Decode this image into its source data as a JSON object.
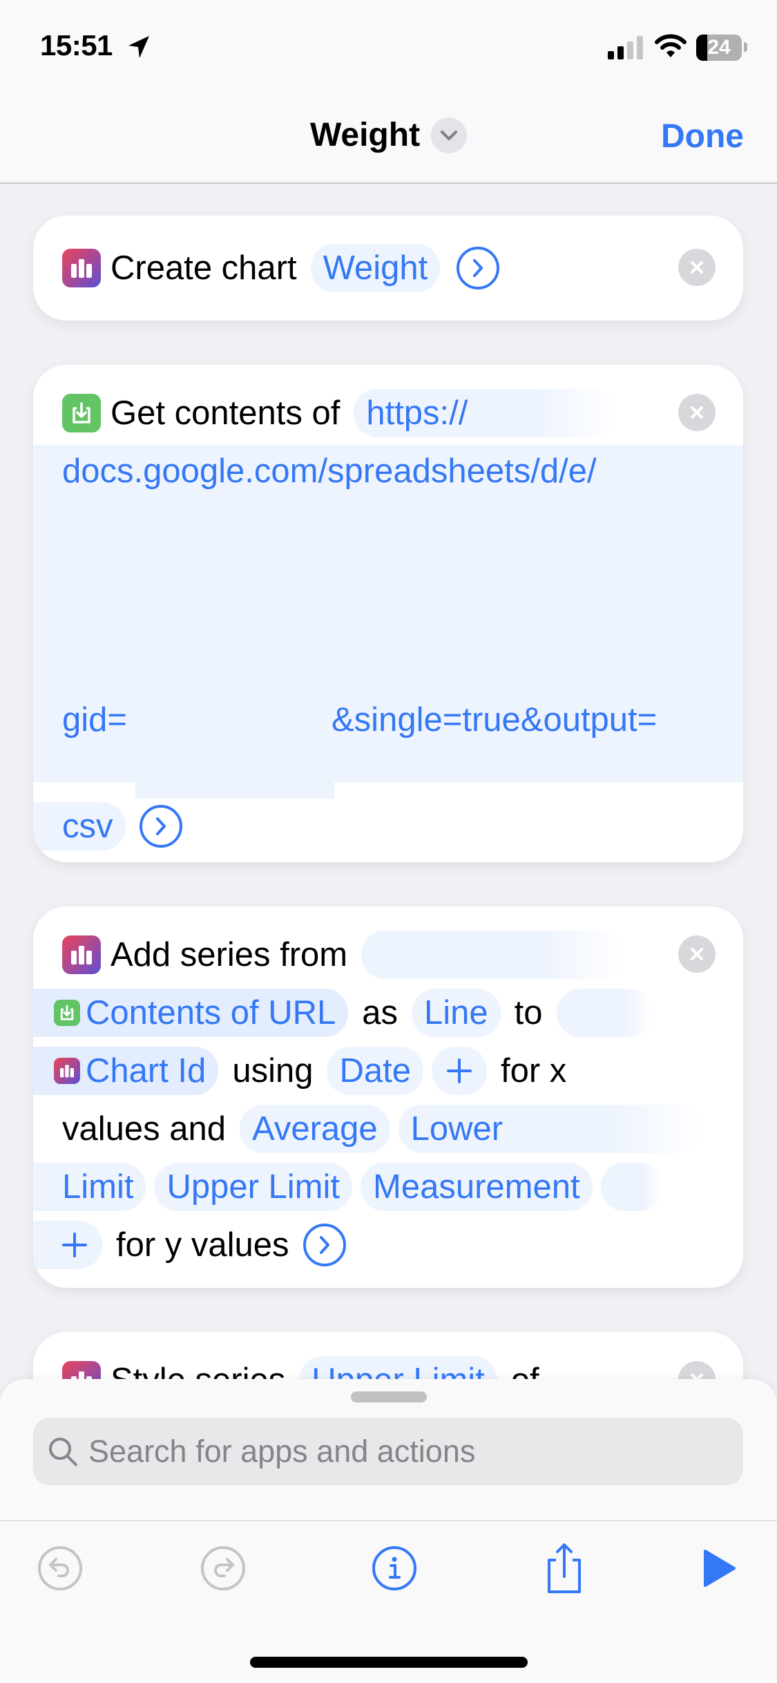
{
  "status_bar": {
    "time": "15:51",
    "battery_percent": "24",
    "battery_level": 0.24,
    "signal_bars_active": 2,
    "signal_bars_total": 4
  },
  "nav": {
    "title": "Weight",
    "done_label": "Done"
  },
  "actions": [
    {
      "app": "Charts",
      "icon": "chart-bars-icon",
      "label": "Create chart",
      "params": {
        "name": "Weight"
      }
    },
    {
      "app": "Web",
      "icon": "download-icon",
      "label": "Get contents of",
      "url_lines": [
        "https://",
        "docs.google.com/spreadsheets/d/e/",
        "gid=",
        "&single=true&output=",
        "csv"
      ]
    },
    {
      "app": "Charts",
      "icon": "chart-bars-icon",
      "label": "Add series from",
      "tokens": {
        "input_variable": "Contents of URL",
        "as": "as",
        "series_type": "Line",
        "to": "to",
        "chart_variable": "Chart Id",
        "using": "using",
        "x_field": "Date",
        "plus": "+",
        "for_x": "for x",
        "values_and": "values and",
        "y_fields": [
          "Average",
          "Lower",
          "Limit",
          "Upper Limit",
          "Measurement"
        ],
        "for_y": "for y values"
      }
    },
    {
      "app": "Charts",
      "icon": "chart-bars-icon",
      "label": "Style series",
      "params": {
        "series": "Upper Limit",
        "of": "of"
      }
    }
  ],
  "bottom_sheet": {
    "search_placeholder": "Search for apps and actions"
  },
  "toolbar": {
    "undo": "undo",
    "redo": "redo",
    "info": "info",
    "share": "share",
    "run": "run"
  },
  "colors": {
    "accent": "#3478f6",
    "charts_gradient_start": "#e8455a",
    "charts_gradient_end": "#5a4fd4",
    "web_green": "#62c465",
    "disabled": "#c4c4c6"
  }
}
